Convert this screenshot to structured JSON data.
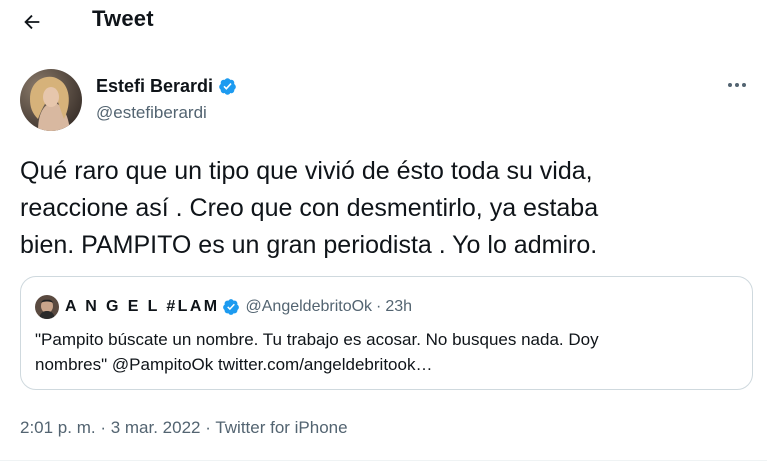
{
  "header": {
    "title": "Tweet",
    "back_icon": "back-arrow-icon"
  },
  "author": {
    "display_name": "Estefi Berardi",
    "handle": "@estefiberardi",
    "verified": true,
    "verified_icon": "verified-badge-icon"
  },
  "more_icon": "more-options-icon",
  "tweet": {
    "lines": [
      "Qué raro que un tipo que vivió de ésto toda su vida,",
      "reaccione así . Creo que con desmentirlo, ya estaba",
      "bien. PAMPITO es un gran periodista . Yo lo admiro."
    ]
  },
  "quote": {
    "name": "A N G E L #LAM",
    "handle": "@AngeldebritoOk",
    "separator": "·",
    "time": "23h",
    "verified": true,
    "lines": [
      "\"Pampito búscate un nombre. Tu trabajo es acosar. No busques nada. Doy",
      "nombres\" @PampitoOk twitter.com/angeldebritook…"
    ]
  },
  "meta": {
    "time": "2:01 p. m.",
    "sep1": " · ",
    "date": "3 mar. 2022",
    "sep2": " · ",
    "source": "Twitter for iPhone"
  },
  "colors": {
    "text_primary": "#0f1419",
    "text_secondary": "#536471",
    "verified_blue": "#1d9bf0",
    "border": "#cfd9de"
  }
}
